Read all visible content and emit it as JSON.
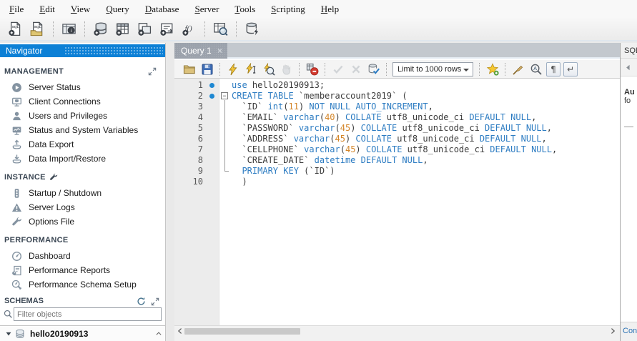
{
  "menu": {
    "items": [
      "File",
      "Edit",
      "View",
      "Query",
      "Database",
      "Server",
      "Tools",
      "Scripting",
      "Help"
    ]
  },
  "main_toolbar": {
    "buttons": [
      {
        "name": "new-query-tab-button",
        "icon": "doc-plus"
      },
      {
        "name": "open-sql-file-button",
        "icon": "doc-open"
      },
      {
        "sep": true
      },
      {
        "name": "inspector-button",
        "icon": "inspector"
      },
      {
        "sep": true
      },
      {
        "name": "create-schema-button",
        "icon": "db-plus"
      },
      {
        "name": "create-table-button",
        "icon": "table-plus"
      },
      {
        "name": "create-view-button",
        "icon": "view-plus"
      },
      {
        "name": "create-procedure-button",
        "icon": "proc-plus"
      },
      {
        "name": "create-function-button",
        "icon": "func-plus"
      },
      {
        "sep": true
      },
      {
        "name": "search-data-button",
        "icon": "table-search"
      },
      {
        "sep": true
      },
      {
        "name": "reconnect-db-button",
        "icon": "db-bolt"
      }
    ]
  },
  "navigator": {
    "title": "Navigator",
    "sections": [
      {
        "title": "MANAGEMENT",
        "header_icon": "expand",
        "header_icon_name": "expand-panel-icon",
        "header_icon_align": "right",
        "items": [
          {
            "label": "Server Status",
            "icon": "play",
            "name": "server-status"
          },
          {
            "label": "Client Connections",
            "icon": "monitor-db",
            "name": "client-connections"
          },
          {
            "label": "Users and Privileges",
            "icon": "person",
            "name": "users-privileges"
          },
          {
            "label": "Status and System Variables",
            "icon": "monitor-chart",
            "name": "status-system-variables"
          },
          {
            "label": "Data Export",
            "icon": "tray-up",
            "name": "data-export"
          },
          {
            "label": "Data Import/Restore",
            "icon": "tray-down",
            "name": "data-import-restore"
          }
        ]
      },
      {
        "title": "INSTANCE",
        "header_icon": "wrench-dark",
        "header_icon_name": "instance-wrench-icon",
        "header_icon_align": "inline",
        "items": [
          {
            "label": "Startup / Shutdown",
            "icon": "traffic",
            "name": "startup-shutdown"
          },
          {
            "label": "Server Logs",
            "icon": "warning",
            "name": "server-logs"
          },
          {
            "label": "Options File",
            "icon": "wrench",
            "name": "options-file"
          }
        ]
      },
      {
        "title": "PERFORMANCE",
        "items": [
          {
            "label": "Dashboard",
            "icon": "gauge",
            "name": "dashboard"
          },
          {
            "label": "Performance Reports",
            "icon": "report",
            "name": "performance-reports"
          },
          {
            "label": "Performance Schema Setup",
            "icon": "gauge-wrench",
            "name": "performance-schema-setup"
          }
        ]
      }
    ],
    "schemas": {
      "title": "SCHEMAS",
      "filter_placeholder": "Filter objects",
      "items": [
        {
          "name": "hello20190913",
          "expanded": true
        }
      ]
    }
  },
  "editor": {
    "tab_label": "Query 1",
    "toolbar": {
      "limit_dropdown": "Limit to 1000 rows",
      "items": [
        {
          "name": "open-script-button",
          "icon": "folder"
        },
        {
          "name": "save-script-button",
          "icon": "floppy"
        },
        {
          "sep": true
        },
        {
          "name": "execute-button",
          "icon": "bolt"
        },
        {
          "name": "execute-current-button",
          "icon": "bolt-cursor"
        },
        {
          "name": "explain-button",
          "icon": "bolt-magnifier"
        },
        {
          "name": "stop-button",
          "icon": "hand",
          "disabled": true
        },
        {
          "sep": true
        },
        {
          "name": "toggle-stop-on-error-button",
          "icon": "stop-error"
        },
        {
          "sep": true
        },
        {
          "name": "commit-button",
          "icon": "check",
          "disabled": true
        },
        {
          "name": "rollback-button",
          "icon": "cross",
          "disabled": true
        },
        {
          "name": "toggle-autocommit-button",
          "icon": "db-check"
        },
        {
          "sep": true
        },
        {
          "type": "dropdown",
          "name": "limit-rows-dropdown"
        },
        {
          "sep": true
        },
        {
          "name": "save-snippet-button",
          "icon": "star-plus"
        },
        {
          "sep": true
        },
        {
          "name": "beautify-button",
          "icon": "broom"
        },
        {
          "name": "find-button",
          "icon": "magnifier-a"
        },
        {
          "type": "toggle",
          "name": "toggle-invisibles-button",
          "glyph": "¶"
        },
        {
          "type": "toggle",
          "name": "toggle-wrap-button",
          "glyph": "↵"
        }
      ]
    },
    "code": {
      "lines": [
        {
          "num": 1,
          "dot": true,
          "fold": "none",
          "tokens": [
            [
              "use ",
              "kw"
            ],
            [
              "hello20190913;",
              "id"
            ]
          ]
        },
        {
          "num": 2,
          "dot": true,
          "fold": "start",
          "tokens": [
            [
              "CREATE TABLE ",
              "kw"
            ],
            [
              "`memberaccount2019` (",
              "id"
            ]
          ]
        },
        {
          "num": 3,
          "fold": "mid",
          "tokens": [
            [
              "  `ID` ",
              "id"
            ],
            [
              "int",
              "kw"
            ],
            [
              "(",
              "id"
            ],
            [
              "11",
              "num"
            ],
            [
              ") ",
              "id"
            ],
            [
              "NOT NULL AUTO_INCREMENT",
              "kw"
            ],
            [
              ",",
              "id"
            ]
          ]
        },
        {
          "num": 4,
          "fold": "mid",
          "tokens": [
            [
              "  `EMAIL` ",
              "id"
            ],
            [
              "varchar",
              "kw"
            ],
            [
              "(",
              "id"
            ],
            [
              "40",
              "num"
            ],
            [
              ") ",
              "id"
            ],
            [
              "COLLATE ",
              "kw"
            ],
            [
              "utf8_unicode_ci ",
              "id"
            ],
            [
              "DEFAULT NULL",
              "kw"
            ],
            [
              ",",
              "id"
            ]
          ]
        },
        {
          "num": 5,
          "fold": "mid",
          "tokens": [
            [
              "  `PASSWORD` ",
              "id"
            ],
            [
              "varchar",
              "kw"
            ],
            [
              "(",
              "id"
            ],
            [
              "45",
              "num"
            ],
            [
              ") ",
              "id"
            ],
            [
              "COLLATE ",
              "kw"
            ],
            [
              "utf8_unicode_ci ",
              "id"
            ],
            [
              "DEFAULT NULL",
              "kw"
            ],
            [
              ",",
              "id"
            ]
          ]
        },
        {
          "num": 6,
          "fold": "mid",
          "tokens": [
            [
              "  `ADDRESS` ",
              "id"
            ],
            [
              "varchar",
              "kw"
            ],
            [
              "(",
              "id"
            ],
            [
              "45",
              "num"
            ],
            [
              ") ",
              "id"
            ],
            [
              "COLLATE ",
              "kw"
            ],
            [
              "utf8_unicode_ci ",
              "id"
            ],
            [
              "DEFAULT NULL",
              "kw"
            ],
            [
              ",",
              "id"
            ]
          ]
        },
        {
          "num": 7,
          "fold": "mid",
          "tokens": [
            [
              "  `CELLPHONE` ",
              "id"
            ],
            [
              "varchar",
              "kw"
            ],
            [
              "(",
              "id"
            ],
            [
              "45",
              "num"
            ],
            [
              ") ",
              "id"
            ],
            [
              "COLLATE ",
              "kw"
            ],
            [
              "utf8_unicode_ci ",
              "id"
            ],
            [
              "DEFAULT NULL",
              "kw"
            ],
            [
              ",",
              "id"
            ]
          ]
        },
        {
          "num": 8,
          "fold": "mid",
          "tokens": [
            [
              "  `CREATE_DATE` ",
              "id"
            ],
            [
              "datetime DEFAULT NULL",
              "kw"
            ],
            [
              ",",
              "id"
            ]
          ]
        },
        {
          "num": 9,
          "fold": "end",
          "tokens": [
            [
              "  ",
              "id"
            ],
            [
              "PRIMARY KEY ",
              "kw"
            ],
            [
              "(`ID`)",
              "id"
            ]
          ]
        },
        {
          "num": 10,
          "fold": "none",
          "tokens": [
            [
              "  )",
              "id"
            ]
          ]
        }
      ]
    }
  },
  "right_panel": {
    "tab_label": "SQL",
    "content_fragments": [
      "Au",
      "fo"
    ],
    "bottom_tab_label": "Con"
  },
  "colors": {
    "accent_blue": "#0c80d6",
    "keyword": "#2d7cc2",
    "number": "#d4862a",
    "plain_text": "#3b3b3b",
    "statement_marker": "#1e88d2",
    "tab_gray": "#9ba2ac"
  }
}
